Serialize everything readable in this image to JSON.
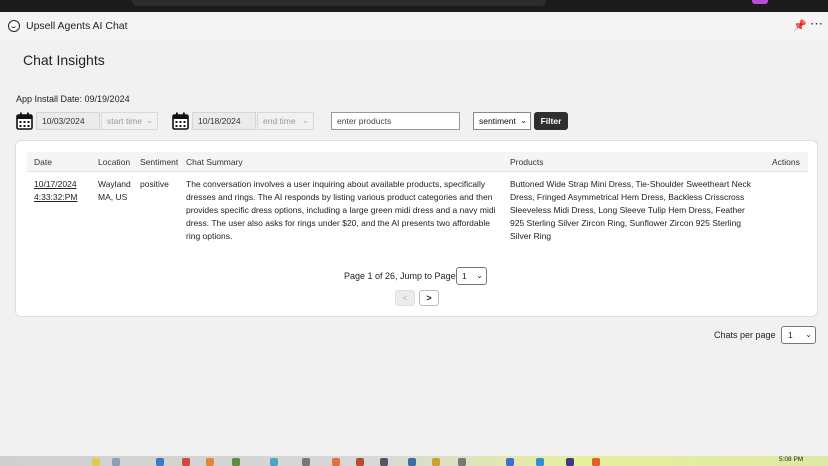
{
  "app": {
    "title": "Upsell Agents AI Chat",
    "page_title": "Chat Insights",
    "install_date": "App Install Date: 09/19/2024"
  },
  "filters": {
    "start_date": "10/03/2024",
    "start_time_placeholder": "start time",
    "end_date": "10/18/2024",
    "end_time_placeholder": "end time",
    "products_placeholder": "enter products",
    "sentiment_value": "sentiment",
    "filter_label": "Filter"
  },
  "table": {
    "headers": {
      "date": "Date",
      "location": "Location",
      "sentiment": "Sentiment",
      "summary": "Chat Summary",
      "products": "Products",
      "actions": "Actions"
    },
    "rows": [
      {
        "date": "10/17/2024 4:33:32:PM",
        "location": "Wayland MA, US",
        "sentiment": "positive",
        "summary": "The conversation involves a user inquiring about available products, specifically dresses and rings. The AI responds by listing various product categories and then provides specific dress options, including a large green midi dress and a navy midi dress. The user also asks for rings under $20, and the AI presents two affordable ring options.",
        "products": "Buttoned Wide Strap Mini Dress, Tie-Shoulder Sweetheart Neck Dress, Fringed Asymmetrical Hem Dress, Backless Crisscross Sleeveless Midi Dress, Long Sleeve Tulip Hem Dress, Feather 925 Sterling Silver Zircon Ring, Sunflower Zircon 925 Sterling Silver Ring"
      }
    ]
  },
  "pagination": {
    "text": "Page 1 of 26, Jump to Page",
    "page_value": "1",
    "prev_label": "<",
    "next_label": ">"
  },
  "per_page": {
    "label": "Chats per page",
    "value": "1"
  },
  "taskbar": {
    "clock": "5:08 PM"
  },
  "colors": {
    "filter_button": "#2e2e2e",
    "topbar": "#1b1b1b",
    "badge": "#b64fd6"
  }
}
